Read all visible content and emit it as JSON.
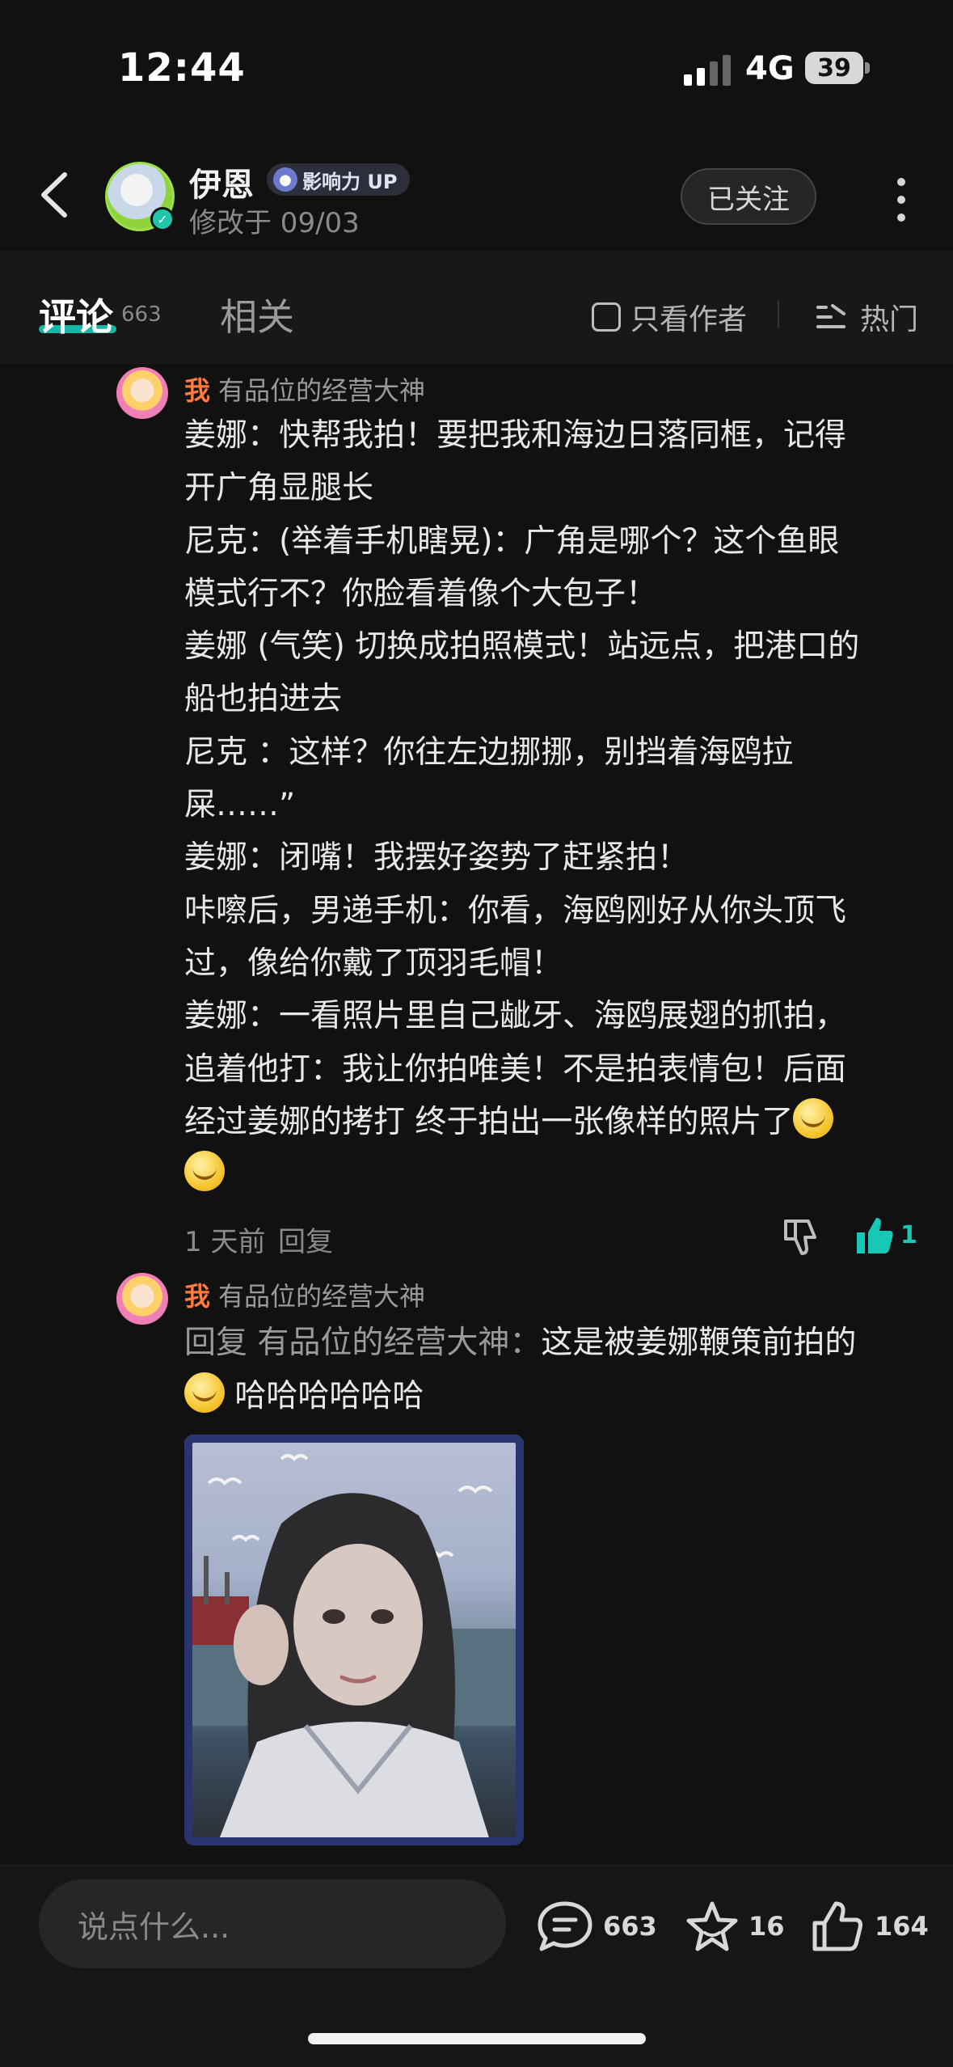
{
  "status_bar": {
    "time": "12:44",
    "network": "4G",
    "battery": "39"
  },
  "header": {
    "author_name": "伊恩",
    "badge_label": "影响力 UP",
    "edit_time": "修改于 09/03",
    "follow_label": "已关注"
  },
  "tabs": {
    "comments_label": "评论",
    "comments_count": "663",
    "related_label": "相关",
    "only_author_label": "只看作者",
    "sort_label": "热门"
  },
  "comment1": {
    "me_tag": "我",
    "username": "有品位的经营大神",
    "lines": [
      "姜娜：快帮我拍！要把我和海边日落同框，记得",
      "开广角显腿长",
      "尼克：(举着手机瞎晃)：广角是哪个？这个鱼眼",
      "模式行不？你脸看着像个大包子！",
      "姜娜 (气笑) 切换成拍照模式！站远点，把港口的",
      "船也拍进去",
      "尼克 ：这样？你往左边挪挪，别挡着海鸥拉",
      "屎……”",
      "姜娜：闭嘴！我摆好姿势了赶紧拍！",
      "咔嚓后，男递手机：你看，海鸥刚好从你头顶飞",
      "过，像给你戴了顶羽毛帽！",
      "姜娜：一看照片里自己龇牙、海鸥展翅的抓拍，",
      "追着他打：我让你拍唯美！不是拍表情包！后面",
      "经过姜娜的拷打 终于拍出一张像样的照片了"
    ],
    "time": "1 天前",
    "reply_label": "回复",
    "like_count": "1"
  },
  "comment2": {
    "me_tag": "我",
    "username": "有品位的经营大神",
    "reply_prefix": "回复 有品位的经营大神：",
    "text_line1": "这是被姜娜鞭策前拍的",
    "text_line2": "哈哈哈哈哈哈"
  },
  "bottom_bar": {
    "input_placeholder": "说点什么...",
    "comment_count": "663",
    "favorite_count": "16",
    "like_count": "164"
  },
  "colors": {
    "background": "#111111",
    "accent_teal": "#18c8b6",
    "me_orange": "#ff7a3d"
  },
  "icons": [
    "back-arrow-icon",
    "verified-icon",
    "more-icon",
    "checkbox-icon",
    "sort-hot-icon",
    "dislike-icon",
    "like-icon",
    "comment-icon",
    "star-icon",
    "thumb-up-icon",
    "emoji-icon"
  ]
}
